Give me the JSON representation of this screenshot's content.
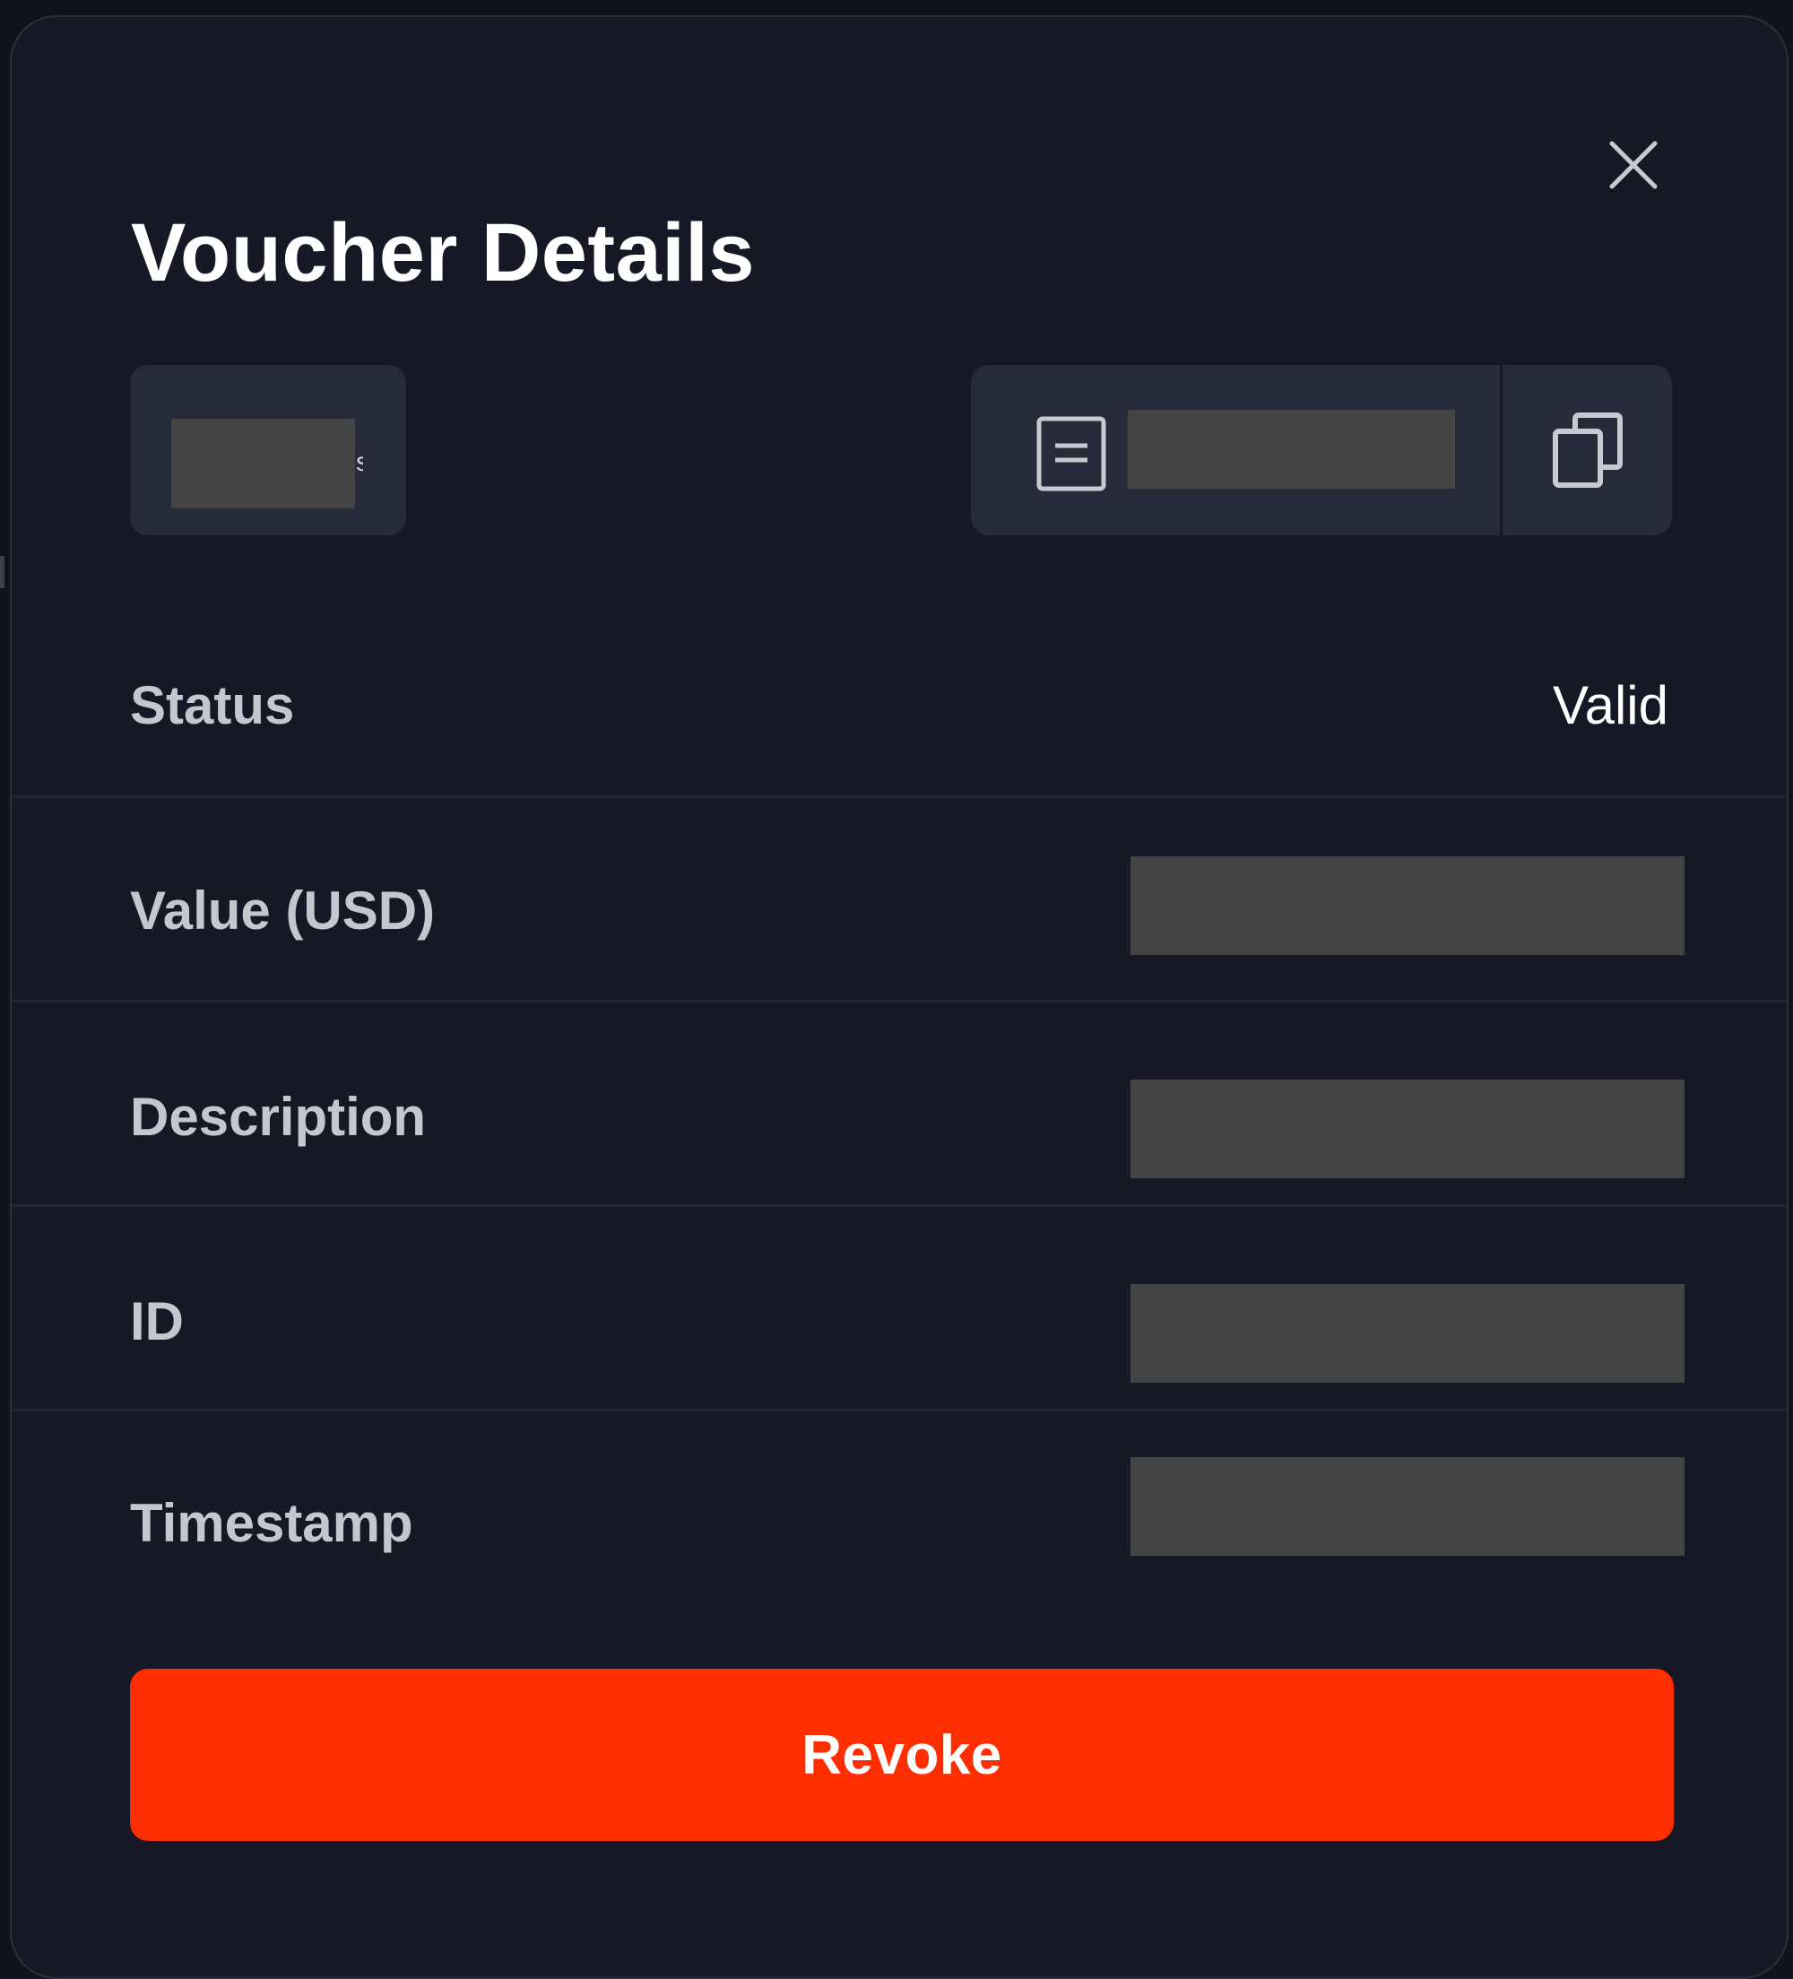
{
  "modal": {
    "title": "Voucher Details",
    "close_icon": "close-icon"
  },
  "chip": {
    "text": "",
    "visible_tail": "s"
  },
  "voucher_code": {
    "icon": "document-icon",
    "value": "",
    "copy_icon": "copy-icon"
  },
  "details": {
    "status": {
      "label": "Status",
      "value": "Valid"
    },
    "value_usd": {
      "label": "Value (USD)",
      "value": ""
    },
    "description": {
      "label": "Description",
      "value": ""
    },
    "id": {
      "label": "ID",
      "value": ""
    },
    "timestamp": {
      "label": "Timestamp",
      "value": ""
    }
  },
  "actions": {
    "revoke_label": "Revoke"
  },
  "colors": {
    "modal_background": "#161826",
    "page_background": "#10121e",
    "surface": "#272a38",
    "label_text": "#c6c7ce",
    "redaction": "#444444",
    "danger": "#ff2e00"
  }
}
